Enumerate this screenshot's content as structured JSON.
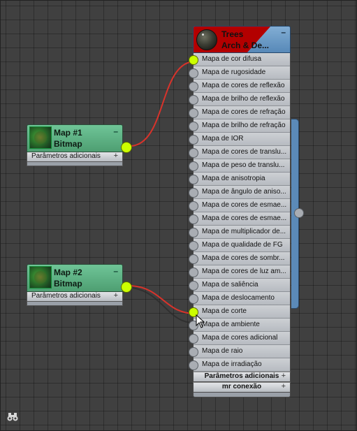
{
  "bitmap_nodes": [
    {
      "title": "Map #1",
      "subtitle": "Bitmap",
      "section": "Parâmetros adicionais",
      "plus": "+",
      "minimize": "–"
    },
    {
      "title": "Map #2",
      "subtitle": "Bitmap",
      "section": "Parâmetros adicionais",
      "plus": "+",
      "minimize": "–"
    }
  ],
  "material": {
    "title_line1": "Trees",
    "title_line2": "Arch & De...",
    "minimize": "–",
    "slots": [
      {
        "label": "Mapa de cor difusa",
        "connected": true
      },
      {
        "label": "Mapa de rugosidade",
        "connected": false
      },
      {
        "label": "Mapa de cores de reflexão",
        "connected": false
      },
      {
        "label": "Mapa de brilho de reflexão",
        "connected": false
      },
      {
        "label": "Mapa de cores de refração",
        "connected": false
      },
      {
        "label": "Mapa de brilho de refração",
        "connected": false
      },
      {
        "label": "Mapa de IOR",
        "connected": false
      },
      {
        "label": "Mapa de cores de translu...",
        "connected": false
      },
      {
        "label": "Mapa de peso de translu...",
        "connected": false
      },
      {
        "label": "Mapa de anisotropia",
        "connected": false
      },
      {
        "label": "Mapa de ângulo de aniso...",
        "connected": false
      },
      {
        "label": "Mapa de cores de esmae...",
        "connected": false
      },
      {
        "label": "Mapa de cores de esmae...",
        "connected": false
      },
      {
        "label": "Mapa de multiplicador de...",
        "connected": false
      },
      {
        "label": "Mapa de qualidade de FG",
        "connected": false
      },
      {
        "label": "Mapa de cores de sombr...",
        "connected": false
      },
      {
        "label": "Mapa de cores de luz am...",
        "connected": false
      },
      {
        "label": "Mapa de saliência",
        "connected": false
      },
      {
        "label": "Mapa de deslocamento",
        "connected": false
      },
      {
        "label": "Mapa de corte",
        "connected": true
      },
      {
        "label": "Mapa de ambiente",
        "connected": false
      },
      {
        "label": "Mapa de cores adicional",
        "connected": false
      },
      {
        "label": "Mapa de raio",
        "connected": false
      },
      {
        "label": "Mapa de irradiação",
        "connected": false
      }
    ],
    "sections": [
      {
        "label": "Parâmetros adicionais",
        "plus": "+"
      },
      {
        "label": "mr conexão",
        "plus": "+"
      }
    ]
  },
  "colors": {
    "wire": "#d8332b",
    "port_connected": "#ccff00",
    "bitmap_header": "#5bb383",
    "material_header": "#6a9cc8",
    "material_tag": "#b30000",
    "canvas": "#404040"
  },
  "icons": {
    "navigator": "binoculars-icon",
    "cursor": "mouse-pointer-icon"
  }
}
